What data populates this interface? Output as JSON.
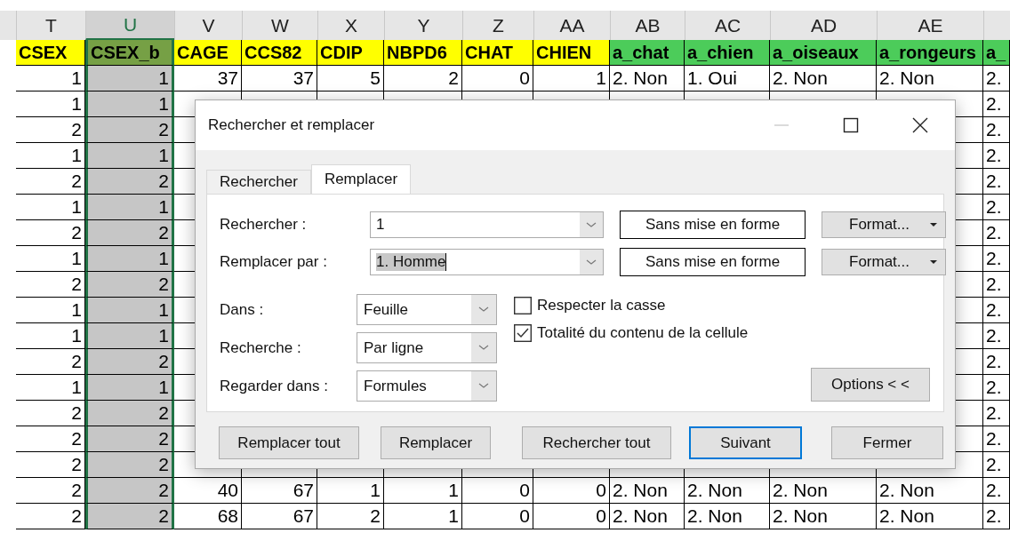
{
  "sheet": {
    "columns": [
      {
        "letter": "T",
        "header": "CSEX",
        "color": "#ffff00",
        "kind": "number",
        "selected": false
      },
      {
        "letter": "U",
        "header": "CSEX_b",
        "color": "#76a045",
        "kind": "number",
        "selected": true
      },
      {
        "letter": "V",
        "header": "CAGE",
        "color": "#ffff00",
        "kind": "number",
        "selected": false
      },
      {
        "letter": "W",
        "header": "CCS82",
        "color": "#ffff00",
        "kind": "number",
        "selected": false
      },
      {
        "letter": "X",
        "header": "CDIP",
        "color": "#ffff00",
        "kind": "number",
        "selected": false
      },
      {
        "letter": "Y",
        "header": "NBPD6",
        "color": "#ffff00",
        "kind": "number",
        "selected": false
      },
      {
        "letter": "Z",
        "header": "CHAT",
        "color": "#ffff00",
        "kind": "number",
        "selected": false
      },
      {
        "letter": "AA",
        "header": "CHIEN",
        "color": "#ffff00",
        "kind": "number",
        "selected": false
      },
      {
        "letter": "AB",
        "header": "a_chat",
        "color": "#4ccc5a",
        "kind": "text",
        "selected": false
      },
      {
        "letter": "AC",
        "header": "a_chien",
        "color": "#4ccc5a",
        "kind": "text",
        "selected": false
      },
      {
        "letter": "AD",
        "header": "a_oiseaux",
        "color": "#4ccc5a",
        "kind": "text",
        "selected": false
      },
      {
        "letter": "AE",
        "header": "a_rongeurs",
        "color": "#4ccc5a",
        "kind": "text",
        "selected": false
      },
      {
        "header": "a_",
        "color": "#4ccc5a",
        "kind": "text",
        "selected": false
      }
    ],
    "rows": [
      {
        "cells": [
          "1",
          "1",
          "37",
          "37",
          "5",
          "2",
          "0",
          "1",
          "2. Non",
          "1. Oui",
          "2. Non",
          "2. Non",
          "2."
        ]
      },
      {
        "cells": [
          "1",
          "1",
          null,
          null,
          null,
          null,
          null,
          null,
          null,
          null,
          null,
          null,
          "2."
        ]
      },
      {
        "cells": [
          "2",
          "2",
          null,
          null,
          null,
          null,
          null,
          null,
          null,
          null,
          null,
          null,
          "2."
        ]
      },
      {
        "cells": [
          "1",
          "1",
          null,
          null,
          null,
          null,
          null,
          null,
          null,
          null,
          null,
          null,
          "2."
        ]
      },
      {
        "cells": [
          "2",
          "2",
          null,
          null,
          null,
          null,
          null,
          null,
          null,
          null,
          null,
          null,
          "2."
        ]
      },
      {
        "cells": [
          "1",
          "1",
          null,
          null,
          null,
          null,
          null,
          null,
          null,
          null,
          null,
          null,
          "2."
        ]
      },
      {
        "cells": [
          "2",
          "2",
          null,
          null,
          null,
          null,
          null,
          null,
          null,
          null,
          null,
          null,
          "2."
        ]
      },
      {
        "cells": [
          "1",
          "1",
          null,
          null,
          null,
          null,
          null,
          null,
          null,
          null,
          null,
          null,
          "2."
        ]
      },
      {
        "cells": [
          "2",
          "2",
          null,
          null,
          null,
          null,
          null,
          null,
          null,
          null,
          null,
          null,
          "2."
        ]
      },
      {
        "cells": [
          "1",
          "1",
          null,
          null,
          null,
          null,
          null,
          null,
          null,
          null,
          null,
          null,
          "2."
        ]
      },
      {
        "cells": [
          "1",
          "1",
          null,
          null,
          null,
          null,
          null,
          null,
          null,
          null,
          null,
          null,
          "2."
        ]
      },
      {
        "cells": [
          "2",
          "2",
          null,
          null,
          null,
          null,
          null,
          null,
          null,
          null,
          null,
          null,
          "2."
        ]
      },
      {
        "cells": [
          "1",
          "1",
          null,
          null,
          null,
          null,
          null,
          null,
          null,
          null,
          null,
          null,
          "2."
        ]
      },
      {
        "cells": [
          "2",
          "2",
          null,
          null,
          null,
          null,
          null,
          null,
          null,
          null,
          null,
          null,
          "2."
        ]
      },
      {
        "cells": [
          "2",
          "2",
          null,
          null,
          null,
          null,
          null,
          null,
          null,
          null,
          null,
          null,
          "2."
        ]
      },
      {
        "cells": [
          "2",
          "2",
          null,
          null,
          null,
          null,
          null,
          null,
          null,
          null,
          null,
          null,
          "2."
        ]
      },
      {
        "cells": [
          "2",
          "2",
          "40",
          "67",
          "1",
          "1",
          "0",
          "0",
          "2. Non",
          "2. Non",
          "2. Non",
          "2. Non",
          "2."
        ]
      },
      {
        "cells": [
          "2",
          "2",
          "68",
          "67",
          "2",
          "1",
          "0",
          "0",
          "2. Non",
          "2. Non",
          "2. Non",
          "2. Non",
          "2."
        ]
      }
    ]
  },
  "dialog": {
    "title": "Rechercher et remplacer",
    "tabs": [
      {
        "label": "Rechercher",
        "selected": false
      },
      {
        "label": "Remplacer",
        "selected": true
      }
    ],
    "find": {
      "label": "Rechercher :",
      "value": "1",
      "format": "Sans mise en forme",
      "format_button": "Format..."
    },
    "replace": {
      "label": "Remplacer par :",
      "value": "1. Homme",
      "highlighted": true,
      "format": "Sans mise en forme",
      "format_button": "Format..."
    },
    "options": [
      {
        "label": "Dans :",
        "value": "Feuille"
      },
      {
        "label": "Recherche :",
        "value": "Par ligne"
      },
      {
        "label": "Regarder dans :",
        "value": "Formules"
      }
    ],
    "checkboxes": [
      {
        "label": "Respecter la casse",
        "checked": false
      },
      {
        "label": "Totalité du contenu de la cellule",
        "checked": true
      }
    ],
    "options_button": "Options < <",
    "buttons": [
      {
        "label": "Remplacer tout",
        "focused": false
      },
      {
        "label": "Remplacer",
        "focused": false
      },
      {
        "label": "Rechercher tout",
        "focused": false
      },
      {
        "label": "Suivant",
        "focused": true
      },
      {
        "label": "Fermer",
        "focused": false
      }
    ]
  }
}
